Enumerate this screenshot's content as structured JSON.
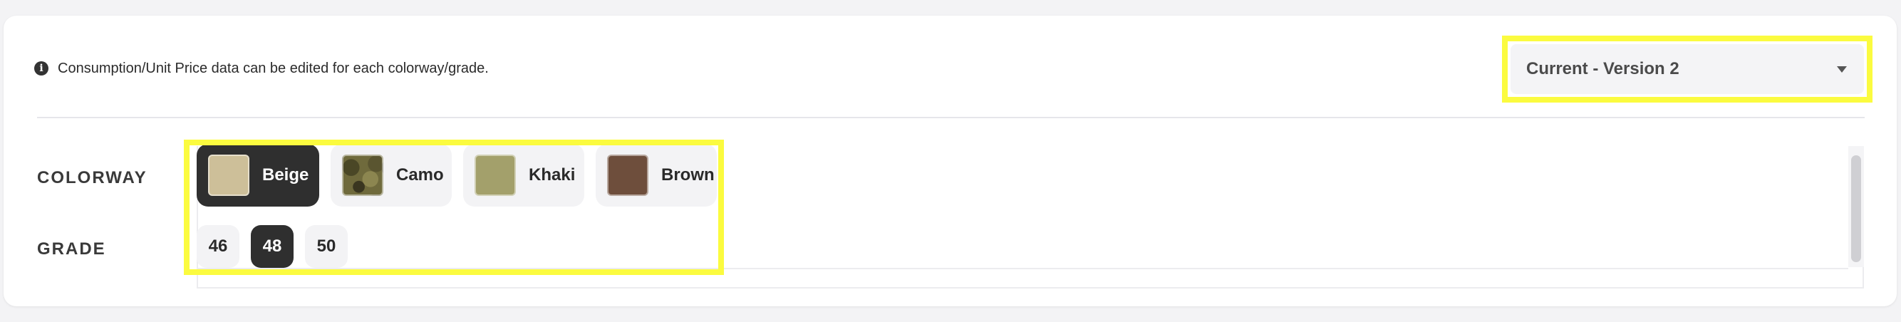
{
  "info": {
    "icon": "info-icon",
    "text": "Consumption/Unit Price data can be edited for each colorway/grade."
  },
  "version_select": {
    "value": "Current - Version 2",
    "icon": "caret-down-icon"
  },
  "colorway": {
    "label": "COLORWAY",
    "options": [
      {
        "name": "Beige",
        "color": "#cdbf99",
        "selected": true
      },
      {
        "name": "Camo",
        "color": "#6f6a3c",
        "selected": false
      },
      {
        "name": "Khaki",
        "color": "#a3a06b",
        "selected": false
      },
      {
        "name": "Brown",
        "color": "#6e4e3c",
        "selected": false
      }
    ]
  },
  "grade": {
    "label": "GRADE",
    "options": [
      {
        "value": "46",
        "selected": false
      },
      {
        "value": "48",
        "selected": true
      },
      {
        "value": "50",
        "selected": false
      }
    ]
  },
  "colors": {
    "highlight": "#fbfb3f",
    "selected_chip": "#2f2f2f",
    "chip": "#f3f3f5"
  }
}
